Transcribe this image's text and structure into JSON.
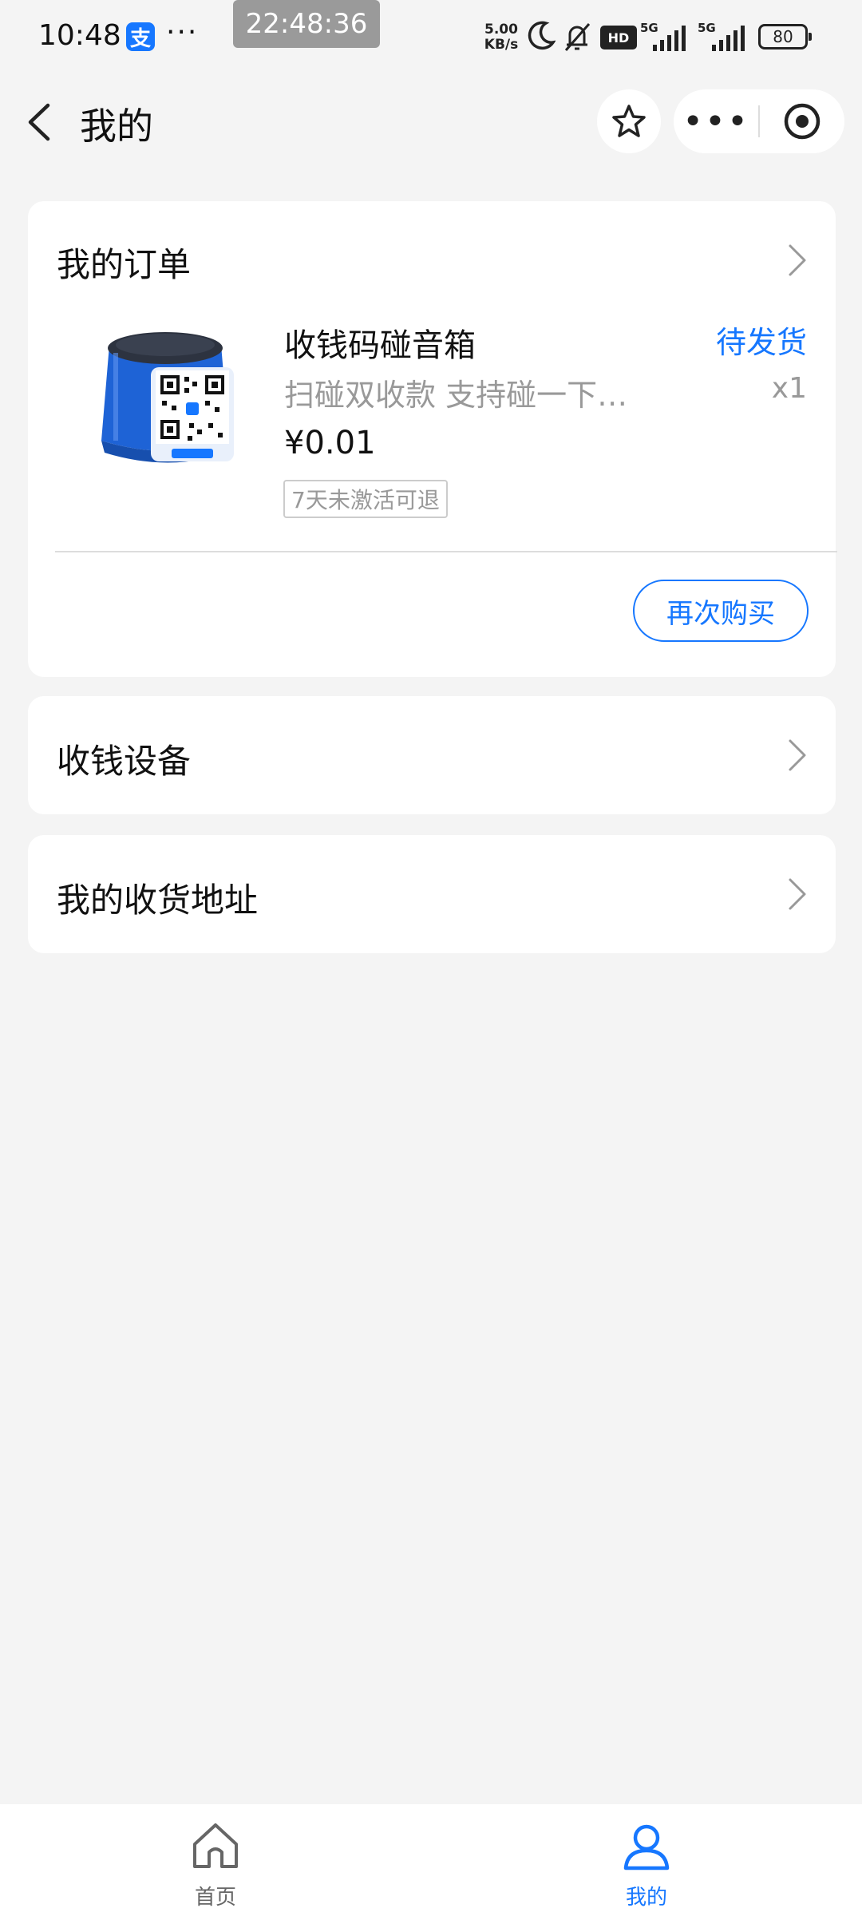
{
  "status_bar": {
    "time": "10:48",
    "app_icon_glyph": "支",
    "dots": "···",
    "overlay_clock": "22:48:36",
    "net_speed_value": "5.00",
    "net_speed_unit": "KB/s",
    "hd_label": "HD",
    "sim1_label": "5G",
    "sim2_label": "5G",
    "battery": "80"
  },
  "nav": {
    "title": "我的",
    "more_glyph": "•••"
  },
  "order_card": {
    "title": "我的订单",
    "product_name": "收钱码碰音箱",
    "status": "待发货",
    "description": "扫碰双收款  支持碰一下…",
    "quantity": "x1",
    "price": "¥0.01",
    "tag": "7天未激活可退",
    "rebuy_label": "再次购买"
  },
  "rows": {
    "devices_label": "收钱设备",
    "address_label": "我的收货地址"
  },
  "tabbar": {
    "home_label": "首页",
    "mine_label": "我的"
  },
  "colors": {
    "accent": "#1677ff",
    "background": "#f4f4f4"
  }
}
